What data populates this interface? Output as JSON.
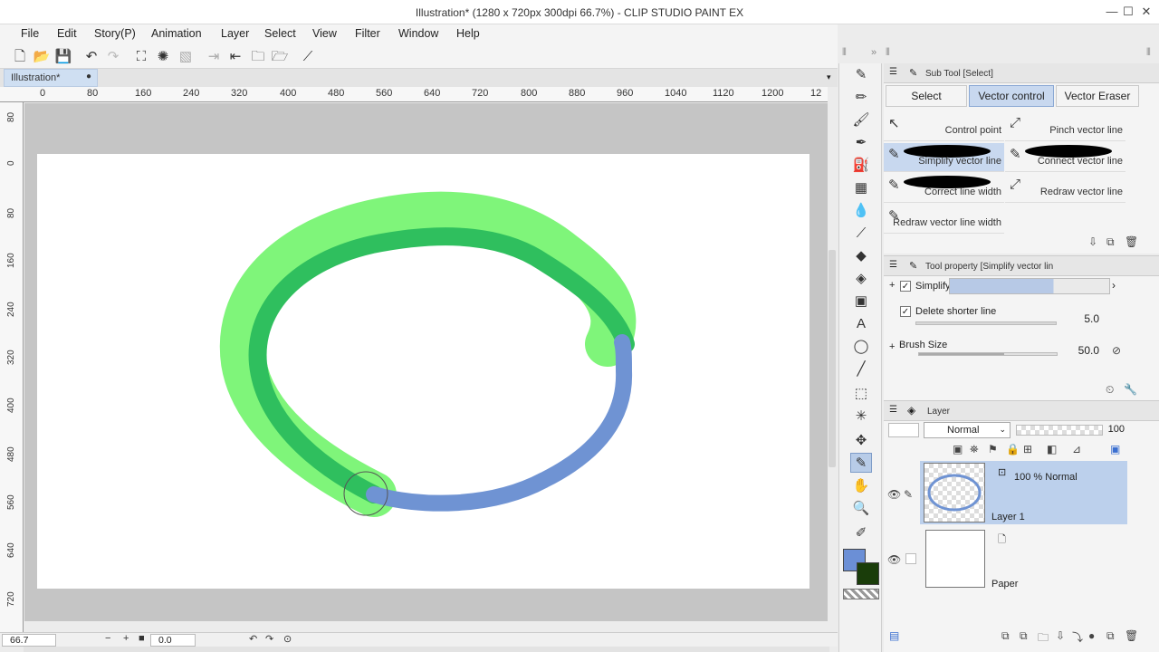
{
  "window": {
    "title": "Illustration* (1280 x 720px 300dpi 66.7%)  - CLIP STUDIO PAINT EX",
    "minimize": "—",
    "maximize": "☐",
    "close": "✕"
  },
  "menu": [
    "File",
    "Edit",
    "Story(P)",
    "Animation",
    "Layer",
    "Select",
    "View",
    "Filter",
    "Window",
    "Help"
  ],
  "document_tab": {
    "label": "Illustration*",
    "close": "●"
  },
  "ruler": {
    "h_labels": [
      "0",
      "80",
      "160",
      "240",
      "320",
      "400",
      "480",
      "560",
      "640",
      "720",
      "800",
      "880",
      "960",
      "1040",
      "1120",
      "1200",
      "12"
    ],
    "v_labels": [
      "80",
      "0",
      "80",
      "160",
      "240",
      "320",
      "400",
      "480",
      "560",
      "640",
      "720"
    ]
  },
  "status": {
    "zoom": "66.7",
    "angle": "0.0"
  },
  "subtool_panel": {
    "header": "Sub Tool [Select]",
    "tabs": [
      "Select",
      "Vector control",
      "Vector Eraser"
    ],
    "active_tab": "Vector control",
    "items": [
      {
        "label": "Control point",
        "icon": "control-point-icon"
      },
      {
        "label": "Pinch vector line",
        "icon": "pinch-icon"
      },
      {
        "label": "Simplify vector line",
        "icon": "simplify-icon",
        "active": true
      },
      {
        "label": "Connect vector line",
        "icon": "connect-icon"
      },
      {
        "label": "Correct line width",
        "icon": "correct-width-icon"
      },
      {
        "label": "Redraw vector line",
        "icon": "redraw-icon"
      },
      {
        "label": "Redraw vector line width",
        "icon": "redraw-width-icon"
      }
    ]
  },
  "tool_property": {
    "header": "Tool property [Simplify vector lin",
    "simplify_label": "Simplify",
    "delete_shorter_label": "Delete shorter line",
    "delete_shorter_value": "5.0",
    "brush_size_label": "Brush Size",
    "brush_size_value": "50.0"
  },
  "layer_panel": {
    "header": "Layer",
    "blend_mode": "Normal",
    "opacity": "100",
    "layers": [
      {
        "name": "Layer 1",
        "mode": "100 % Normal",
        "selected": true
      },
      {
        "name": "Paper",
        "mode": "",
        "selected": false
      }
    ]
  },
  "colors": {
    "main": "#6b8fd6",
    "sub": "#1a3d0a",
    "stroke_green_light": "#7ff57a",
    "stroke_green_dark": "#2fbf5e",
    "stroke_blue": "#6f93d3",
    "selection": "#c8d8ef"
  }
}
